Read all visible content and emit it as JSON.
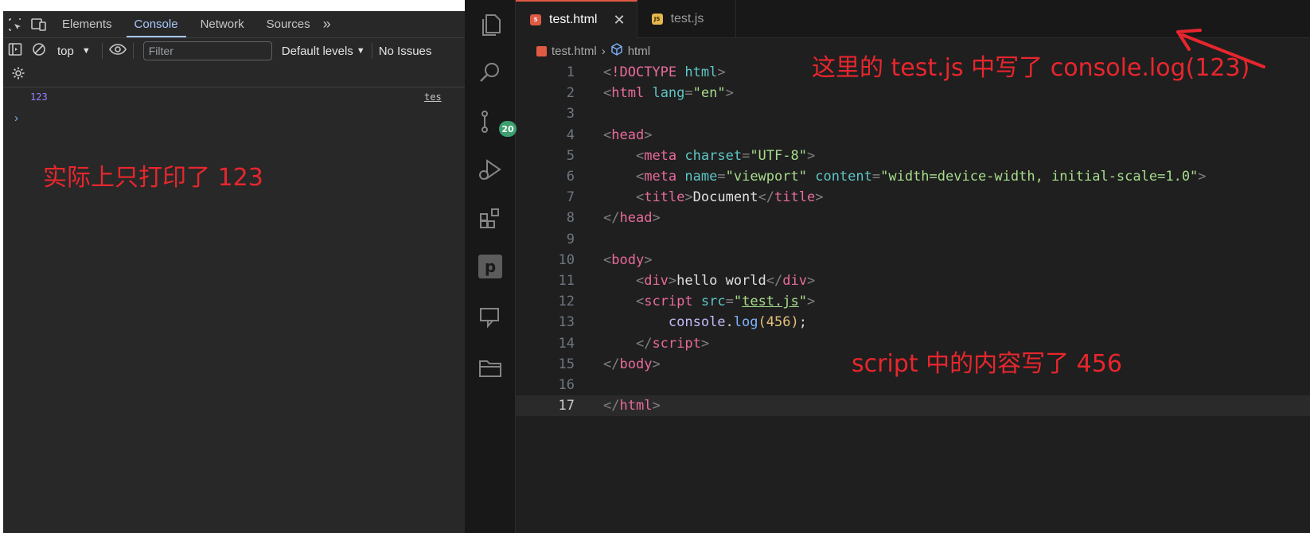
{
  "devtools": {
    "tabs": [
      {
        "label": "Elements"
      },
      {
        "label": "Console"
      },
      {
        "label": "Network"
      },
      {
        "label": "Sources"
      }
    ],
    "toolbar": {
      "context": "top",
      "filter_placeholder": "Filter",
      "levels": "Default levels",
      "issues": "No Issues"
    },
    "console": {
      "log_value": "123",
      "log_source": "tes",
      "prompt": "›"
    }
  },
  "editor": {
    "tabs": [
      {
        "label": "test.html",
        "icon": "html5-icon",
        "active": true
      },
      {
        "label": "test.js",
        "icon": "js-icon",
        "active": false
      }
    ],
    "breadcrumb": {
      "file": "test.html",
      "symbol": "html"
    },
    "scm_badge": "20",
    "current_line": 17,
    "line_numbers": [
      "1",
      "2",
      "3",
      "4",
      "5",
      "6",
      "7",
      "8",
      "9",
      "10",
      "11",
      "12",
      "13",
      "14",
      "15",
      "16",
      "17"
    ],
    "code_text": {
      "l1_doctype": "!DOCTYPE",
      "l1_html": "html",
      "l2_tag": "html",
      "l2_attr": "lang",
      "l2_val": "\"en\"",
      "l4_tag": "head",
      "l5_tag": "meta",
      "l5_attr": "charset",
      "l5_val": "\"UTF-8\"",
      "l6_tag": "meta",
      "l6_attr1": "name",
      "l6_val1": "\"viewport\"",
      "l6_attr2": "content",
      "l6_val2": "\"width=device-width, initial-scale=1.0\"",
      "l7_tag": "title",
      "l7_text": "Document",
      "l8_tag": "head",
      "l10_tag": "body",
      "l11_tag": "div",
      "l11_text": "hello world",
      "l12_tag": "script",
      "l12_attr": "src",
      "l12_val": "test.js",
      "l13_obj": "console",
      "l13_fn": "log",
      "l13_num": "456",
      "l14_tag": "script",
      "l15_tag": "body",
      "l17_tag": "html"
    }
  },
  "annotations": {
    "left": "实际上只打印了 123",
    "top": "这里的 test.js 中写了 console.log(123)",
    "mid": "script 中的内容写了 456"
  },
  "colors": {
    "annotation": "#e8262d",
    "accent_tab": "#a8c7fa",
    "scm_badge": "#3c9f6f"
  }
}
